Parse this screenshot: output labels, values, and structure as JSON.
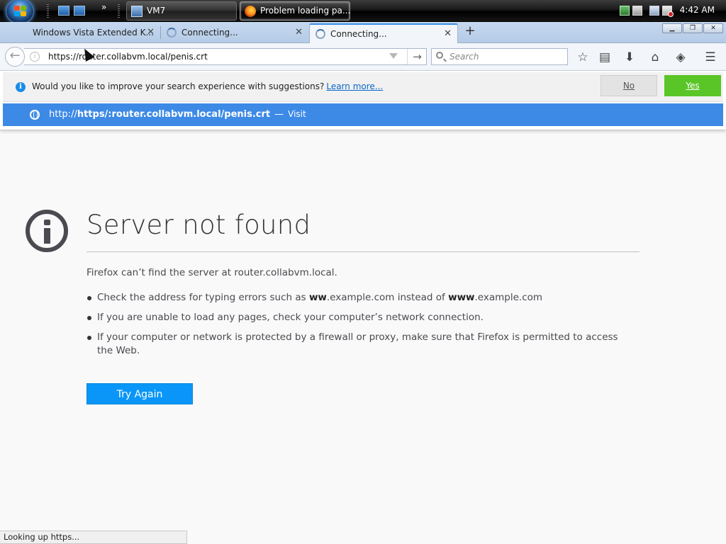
{
  "taskbar": {
    "tasks": [
      {
        "label": "VM7"
      },
      {
        "label": "Problem loading pa..."
      }
    ],
    "quicklaunch_more": "»",
    "clock": "4:42 AM"
  },
  "browser": {
    "tabs": [
      {
        "label": "Windows Vista Extended K..."
      },
      {
        "label": "Connecting..."
      },
      {
        "label": "Connecting..."
      }
    ],
    "tab_close_glyph": "✕",
    "new_tab_glyph": "+",
    "window_buttons": {
      "minimize": "▁",
      "restore": "❐",
      "close": "✕"
    },
    "url": "https://router.collabvm.local/penis.crt",
    "search_placeholder": "Search"
  },
  "suggestion_bar": {
    "question": "Would you like to improve your search experience with suggestions?",
    "learn_more": "Learn more...",
    "no_label": "No",
    "yes_label": "Yes"
  },
  "autocomplete": {
    "prefix": "http://",
    "bold_url": "https/:router.collabvm.local/penis.crt",
    "separator": "—",
    "action": "Visit"
  },
  "error_page": {
    "title": "Server not found",
    "description": "Firefox can’t find the server at router.collabvm.local.",
    "bullets": [
      {
        "pre": "Check the address for typing errors such as ",
        "b1": "ww",
        "mid": ".example.com instead of ",
        "b2": "www",
        "post": ".example.com"
      },
      {
        "text": "If you are unable to load any pages, check your computer’s network connection."
      },
      {
        "text": "If your computer or network is protected by a firewall or proxy, make sure that Firefox is permitted to access the Web."
      }
    ],
    "try_again": "Try Again"
  },
  "status_text": "Looking up https...",
  "colors": {
    "accent_blue": "#3d8ae6",
    "yes_green": "#5ac527",
    "try_again_blue": "#0996f8",
    "info_blue": "#1a8de8"
  },
  "icons": [
    "start-orb-icon",
    "show-desktop-icon",
    "switch-windows-icon",
    "firefox-icon",
    "network-icon",
    "volume-muted-icon",
    "info-icon",
    "globe-icon",
    "search-icon",
    "bookmark-star-icon",
    "reading-list-icon",
    "downloads-icon",
    "home-icon",
    "pocket-icon",
    "menu-icon"
  ]
}
